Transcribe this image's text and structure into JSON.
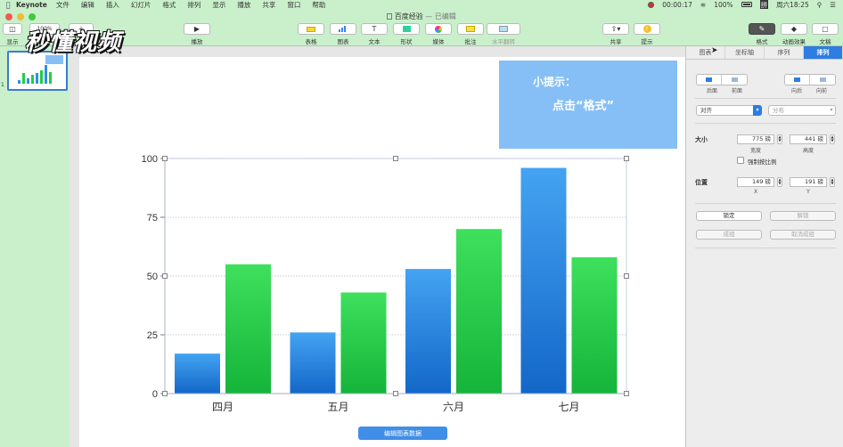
{
  "menubar": {
    "app": "Keynote",
    "items": [
      "文件",
      "编辑",
      "插入",
      "幻灯片",
      "格式",
      "排列",
      "显示",
      "播放",
      "共享",
      "窗口",
      "帮助"
    ],
    "timer": "00:00:17",
    "battery": "100%",
    "ime": "拼",
    "clock": "周六18:25"
  },
  "toolbar": {
    "doc_title": "百度经验",
    "doc_status": "— 已编辑",
    "view_label": "显示",
    "zoom_value": "100%",
    "play_label": "播放",
    "table_label": "表格",
    "chart_label": "图表",
    "text_label": "文本",
    "shape_label": "形状",
    "media_label": "媒体",
    "comment_label": "批注",
    "tilt_label": "水平翻转",
    "share_label": "共享",
    "hint_label": "提示",
    "format_label": "格式",
    "animate_label": "动画效果",
    "document_label": "文稿"
  },
  "navigator": {
    "slide_number": "1"
  },
  "watermark": "秒懂视频",
  "hint": {
    "line1": "小提示：",
    "line2": "点击“格式”"
  },
  "chart_data": {
    "type": "bar",
    "categories": [
      "四月",
      "五月",
      "六月",
      "七月"
    ],
    "series": [
      {
        "values": [
          17,
          26,
          53,
          96
        ],
        "color": "#2f8fe6"
      },
      {
        "values": [
          55,
          43,
          70,
          58
        ],
        "color": "#1fce45"
      }
    ],
    "ylim": [
      0,
      100
    ],
    "yticks": [
      0,
      25,
      50,
      75,
      100
    ],
    "grid": true
  },
  "edit_data_button": "编辑图表数据",
  "inspector": {
    "tabs": [
      "图表",
      "坐标轴",
      "序列",
      "排列"
    ],
    "active_tab": "排列",
    "back_label": "后面",
    "front_label": "前面",
    "backward_label": "向后",
    "forward_label": "向前",
    "align_value": "对齐",
    "distribute_value": "分布",
    "size_title": "大小",
    "width_value": "775 磅",
    "height_value": "441 磅",
    "width_label": "宽度",
    "height_label": "高度",
    "constrain_label": "强制按比例",
    "position_title": "位置",
    "x_value": "149 磅",
    "y_value": "191 磅",
    "x_label": "X",
    "y_label": "Y",
    "lock_label": "锁定",
    "unlock_label": "解锁",
    "group_label": "成组",
    "ungroup_label": "取消成组"
  },
  "colors": {
    "accent": "#2d7de2",
    "hint_bg": "#85bff6",
    "bar_blue": "#2f8fe6",
    "bar_green": "#1fce45"
  }
}
